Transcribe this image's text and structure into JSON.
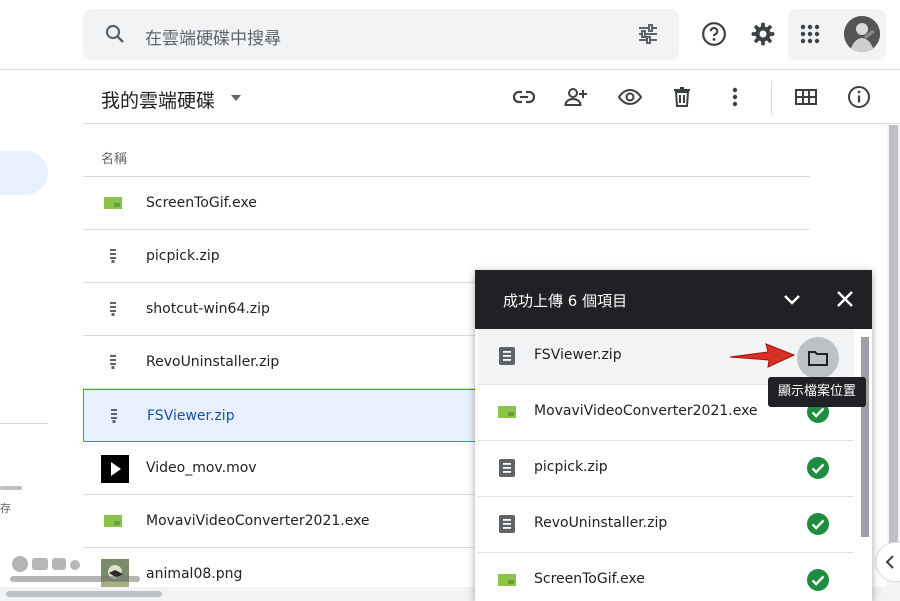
{
  "search": {
    "placeholder": "在雲端硬碟中搜尋"
  },
  "header": {
    "title": "我的雲端硬碟"
  },
  "sidebar": {
    "storage_fragment": "存"
  },
  "list": {
    "column_name": "名稱",
    "files": [
      {
        "name": "ScreenToGif.exe",
        "icon": "exe-icon"
      },
      {
        "name": "picpick.zip",
        "icon": "zip-icon"
      },
      {
        "name": "shotcut-win64.zip",
        "icon": "zip-icon"
      },
      {
        "name": "RevoUninstaller.zip",
        "icon": "zip-icon"
      },
      {
        "name": "FSViewer.zip",
        "icon": "zip-icon",
        "selected": true
      },
      {
        "name": "Video_mov.mov",
        "icon": "video-icon"
      },
      {
        "name": "MovaviVideoConverter2021.exe",
        "icon": "exe-icon"
      },
      {
        "name": "animal08.png",
        "icon": "image-thumbnail"
      }
    ]
  },
  "upload": {
    "title": "成功上傳 6 個項目",
    "tooltip": "顯示檔案位置",
    "items": [
      {
        "name": "FSViewer.zip",
        "icon": "zip-icon",
        "status": "show-location"
      },
      {
        "name": "MovaviVideoConverter2021.exe",
        "icon": "exe-icon",
        "status": "done"
      },
      {
        "name": "picpick.zip",
        "icon": "zip-icon",
        "status": "done"
      },
      {
        "name": "RevoUninstaller.zip",
        "icon": "zip-icon",
        "status": "done"
      },
      {
        "name": "ScreenToGif.exe",
        "icon": "exe-icon",
        "status": "done"
      }
    ]
  },
  "colors": {
    "accent": "#1a73e8",
    "selected_bg": "#e8f0fe",
    "success": "#1e8e3e",
    "exe_green": "#8bc34a",
    "panel_header": "#202124",
    "annotation_arrow": "#d93025"
  }
}
